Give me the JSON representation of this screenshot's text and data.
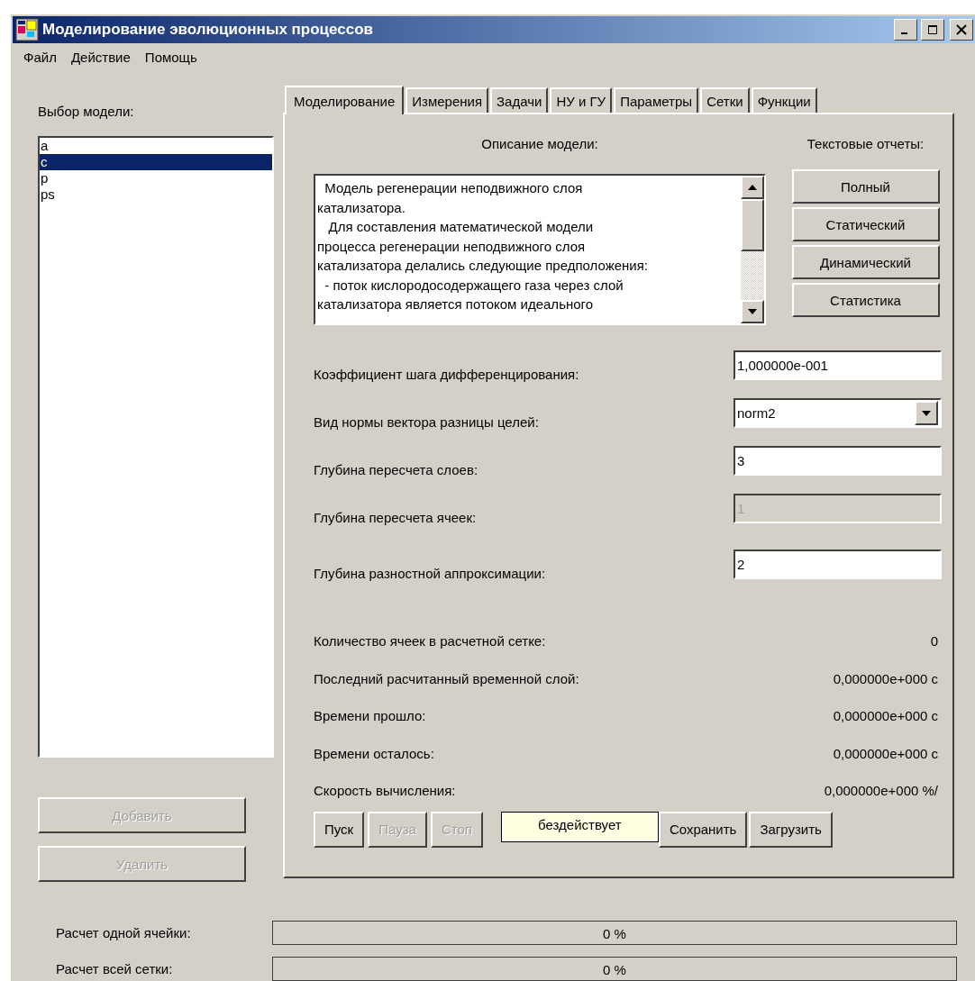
{
  "window": {
    "title": "Моделирование эволюционных процессов"
  },
  "menu": [
    "Файл",
    "Действие",
    "Помощь"
  ],
  "model_list": {
    "label": "Выбор модели:",
    "items": [
      {
        "text": "a",
        "selected": false
      },
      {
        "text": "c",
        "selected": true
      },
      {
        "text": "p",
        "selected": false
      },
      {
        "text": "ps",
        "selected": false
      }
    ]
  },
  "left_buttons": [
    {
      "label": "Добавить",
      "disabled": true
    },
    {
      "label": "Удалить",
      "disabled": true
    }
  ],
  "tabs": [
    {
      "label": "Моделирование",
      "selected": true
    },
    {
      "label": "Измерения",
      "selected": false
    },
    {
      "label": "Задачи",
      "selected": false
    },
    {
      "label": "НУ и ГУ",
      "selected": false
    },
    {
      "label": "Параметры",
      "selected": false
    },
    {
      "label": "Сетки",
      "selected": false
    },
    {
      "label": "Функции",
      "selected": false
    }
  ],
  "description": {
    "label": "Описание модели:",
    "lines": [
      "  Модель регенерации неподвижного слоя",
      "катализатора.",
      "   Для составления математической модели",
      "процесса регенерации неподвижного слоя",
      "катализатора делались следующие предположения:",
      "  - поток кислородосодержащего газа через слой",
      "катализатора является потоком идеального"
    ]
  },
  "reports": {
    "label": "Текстовые отчеты:",
    "buttons": [
      "Полный",
      "Статический",
      "Динамический",
      "Статистика"
    ]
  },
  "fields": [
    {
      "label": "Коэффициент шага дифференцирования:",
      "kind": "text",
      "value": "1,000000e-001",
      "disabled": false
    },
    {
      "label": "Вид нормы вектора разницы целей:",
      "kind": "dropdown",
      "value": "norm2"
    },
    {
      "label": "Глубина пересчета слоев:",
      "kind": "text",
      "value": "3",
      "disabled": false
    },
    {
      "label": "Глубина пересчета ячеек:",
      "kind": "text",
      "value": "1",
      "disabled": true
    },
    {
      "label": "Глубина разностной аппроксимации:",
      "kind": "text",
      "value": "2",
      "disabled": false
    }
  ],
  "stats": [
    {
      "label": "Количество ячеек в расчетной сетке:",
      "value": "0"
    },
    {
      "label": "Последний расчитанный временной слой:",
      "value": "0,000000e+000 с"
    },
    {
      "label": "Времени прошло:",
      "value": "0,000000e+000 с"
    },
    {
      "label": "Времени осталось:",
      "value": "0,000000e+000 с"
    },
    {
      "label": "Скорость вычисления:",
      "value": "0,000000e+000 %/"
    }
  ],
  "controls": [
    {
      "label": "Пуск",
      "disabled": false
    },
    {
      "label": "Пауза",
      "disabled": true
    },
    {
      "label": "Стоп",
      "disabled": true
    }
  ],
  "status": "бездействует",
  "file_buttons": [
    "Сохранить",
    "Загрузить"
  ],
  "progress": [
    {
      "label": "Расчет одной ячейки:",
      "level": 0,
      "reading": "0 %"
    },
    {
      "label": "Расчет всей сетки:",
      "level": 0,
      "reading": "0 %"
    }
  ]
}
